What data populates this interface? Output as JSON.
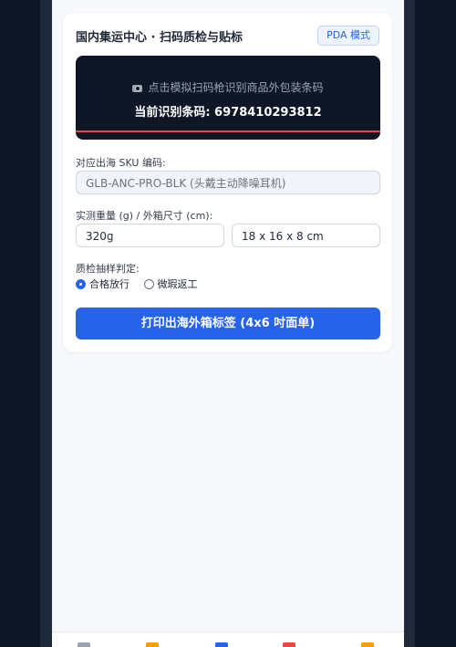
{
  "card": {
    "title": "国内集运中心 · 扫码质检与贴标",
    "mode_badge": "PDA 模式"
  },
  "scanner": {
    "hint": "点击模拟扫码枪识别商品外包装条码",
    "result": "当前识别条码: 6978410293812"
  },
  "sku": {
    "label": "对应出海 SKU 编码:",
    "value": "GLB-ANC-PRO-BLK (头戴主动降噪耳机)"
  },
  "measure": {
    "label": "实测重量 (g) / 外箱尺寸 (cm):",
    "weight": "320g",
    "dimensions": "18 x 16 x 8 cm"
  },
  "qc": {
    "label": "质检抽样判定:",
    "options": [
      {
        "label": "合格放行",
        "selected": true
      },
      {
        "label": "微瑕返工",
        "selected": false
      }
    ]
  },
  "print_button": "打印出海外箱标签 (4x6 吋面单)",
  "colors": {
    "accent": "#2563eb",
    "scanner_bg": "#0f1727",
    "scan_line": "#e24b4b"
  },
  "bottom_nav": [
    {
      "icon": "doc-icon",
      "color": "#9ca3af"
    },
    {
      "icon": "box-icon",
      "color": "#f59e0b"
    },
    {
      "icon": "scan-icon",
      "color": "#2563eb"
    },
    {
      "icon": "truck-icon",
      "color": "#ef4444"
    },
    {
      "icon": "user-icon",
      "color": "#f59e0b"
    }
  ]
}
